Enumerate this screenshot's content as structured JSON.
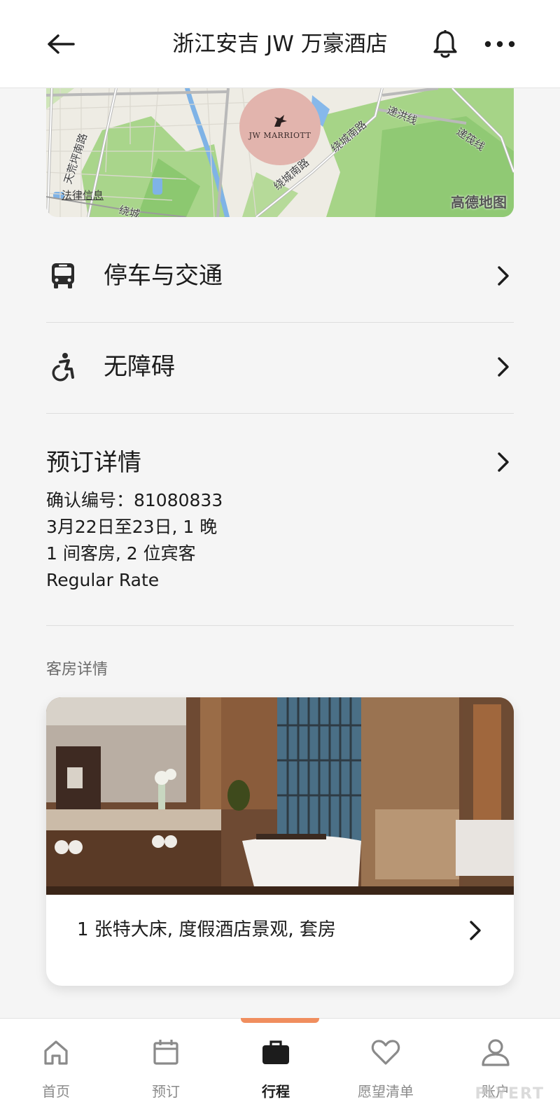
{
  "header": {
    "title": "浙江安吉 JW 万豪酒店",
    "back_icon": "arrow-left-icon",
    "bell_icon": "bell-icon",
    "more_icon": "more-horizontal-icon"
  },
  "map": {
    "marker_logo_text": "JW MARRIOTT",
    "legal_link": "法律信息",
    "brand": "高德地图",
    "roads": [
      "天荒坪南路",
      "绕城南路",
      "绕城南路",
      "递洪线",
      "递筏线",
      "绕城"
    ]
  },
  "rows": [
    {
      "icon": "bus-icon",
      "label": "停车与交通"
    },
    {
      "icon": "accessibility-icon",
      "label": "无障碍"
    }
  ],
  "booking": {
    "heading": "预订详情",
    "confirmation": "确认编号：81080833",
    "dates": "3月22日至23日, 1 晚",
    "guests": "1 间客房, 2 位宾客",
    "rate": "Regular Rate"
  },
  "room_section": {
    "label": "客房详情",
    "room_description": "1 张特大床, 度假酒店景观, 套房"
  },
  "tabbar": {
    "tabs": [
      {
        "label": "首页",
        "icon": "home-icon"
      },
      {
        "label": "预订",
        "icon": "calendar-icon"
      },
      {
        "label": "行程",
        "icon": "briefcase-icon"
      },
      {
        "label": "愿望清单",
        "icon": "heart-icon"
      },
      {
        "label": "账户",
        "icon": "user-icon"
      }
    ],
    "active_index": 2,
    "active_color": "#f08e5e"
  },
  "watermark": "FLYERT"
}
